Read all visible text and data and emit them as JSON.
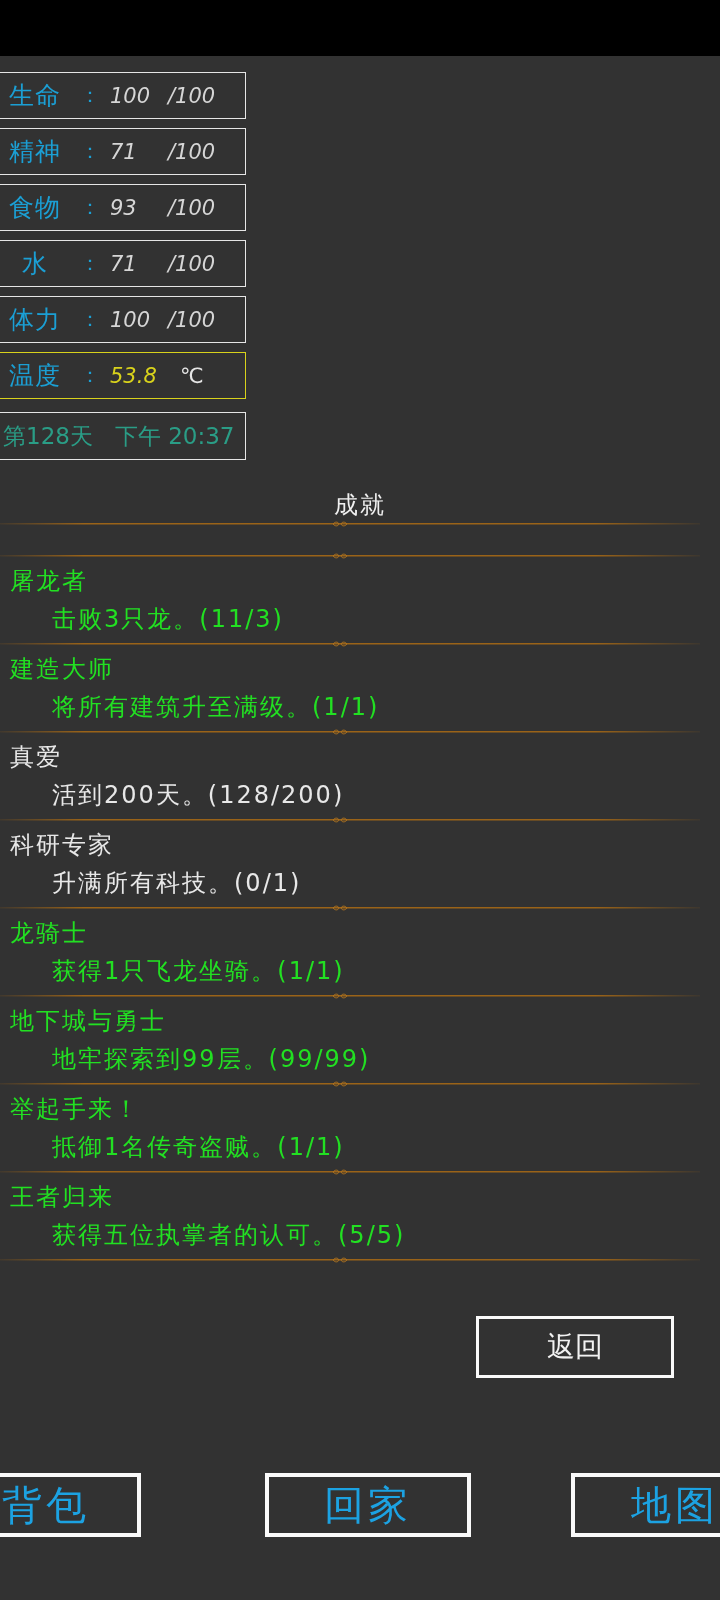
{
  "stats": [
    {
      "kind": "meter",
      "label": "生命",
      "colon": "：",
      "value": "100",
      "max": "/100"
    },
    {
      "kind": "meter",
      "label": "精神",
      "colon": "：",
      "value": "71",
      "max": "/100"
    },
    {
      "kind": "meter",
      "label": "食物",
      "colon": "：",
      "value": "93",
      "max": "/100"
    },
    {
      "kind": "meter",
      "label": "水",
      "colon": "：",
      "value": "71",
      "max": "/100"
    },
    {
      "kind": "meter",
      "label": "体力",
      "colon": "：",
      "value": "100",
      "max": "/100"
    },
    {
      "kind": "temperature",
      "label": "温度",
      "colon": "：",
      "value": "53.8",
      "unit": "℃"
    }
  ],
  "clock": {
    "day": "第128天",
    "time": "下午 20:37"
  },
  "achievements": {
    "title": "成就",
    "items": [
      {
        "name": "屠龙者",
        "description": "击败3只龙。(11/3)",
        "completed": true
      },
      {
        "name": "建造大师",
        "description": "将所有建筑升至满级。(1/1)",
        "completed": true
      },
      {
        "name": "真爱",
        "description": "活到200天。(128/200)",
        "completed": false
      },
      {
        "name": "科研专家",
        "description": "升满所有科技。(0/1)",
        "completed": false
      },
      {
        "name": "龙骑士",
        "description": "获得1只飞龙坐骑。(1/1)",
        "completed": true
      },
      {
        "name": "地下城与勇士",
        "description": "地牢探索到99层。(99/99)",
        "completed": true
      },
      {
        "name": "举起手来！",
        "description": "抵御1名传奇盗贼。(1/1)",
        "completed": true
      },
      {
        "name": "王者归来",
        "description": "获得五位执掌者的认可。(5/5)",
        "completed": true
      }
    ]
  },
  "back_button": "返回",
  "nav_buttons": [
    "背包",
    "回家",
    "地图"
  ]
}
